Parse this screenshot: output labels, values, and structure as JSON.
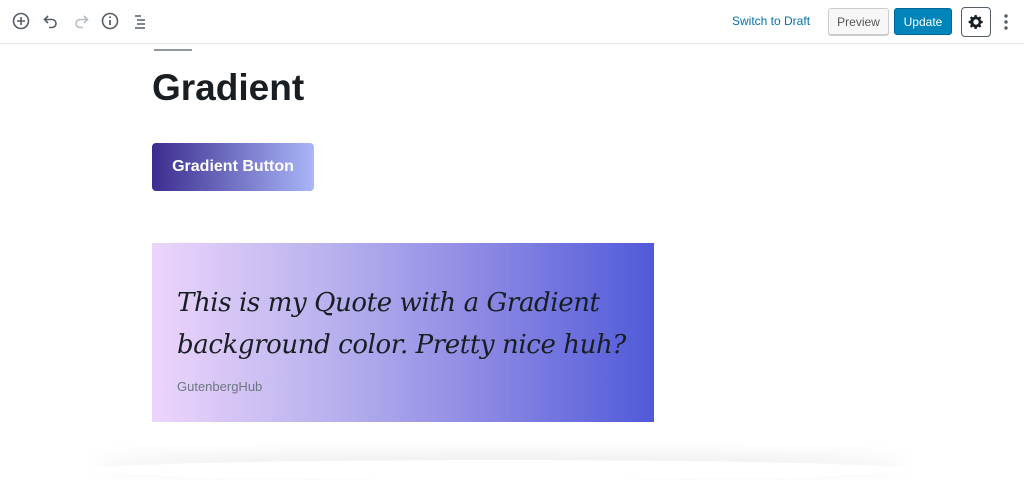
{
  "toolbar": {
    "icons": [
      "add-block-icon",
      "undo-icon",
      "redo-icon",
      "info-icon",
      "block-navigation-icon"
    ],
    "switch_to_draft_label": "Switch to Draft",
    "preview_label": "Preview",
    "update_label": "Update",
    "settings_icon": "gear-icon",
    "more_icon": "vertical-ellipsis-icon"
  },
  "content": {
    "heading": "Gradient",
    "button_label": "Gradient Button",
    "quote": {
      "text": "This is my Quote with a Gradient background color. Pretty nice huh?",
      "citation": "GutenbergHub"
    }
  },
  "colors": {
    "accent": "#0085ba",
    "link": "#0073aa",
    "button_gradient": [
      "#3b2d8f",
      "#a9b6f7"
    ],
    "quote_gradient": [
      "#ecd5fb",
      "#505ad9"
    ]
  }
}
